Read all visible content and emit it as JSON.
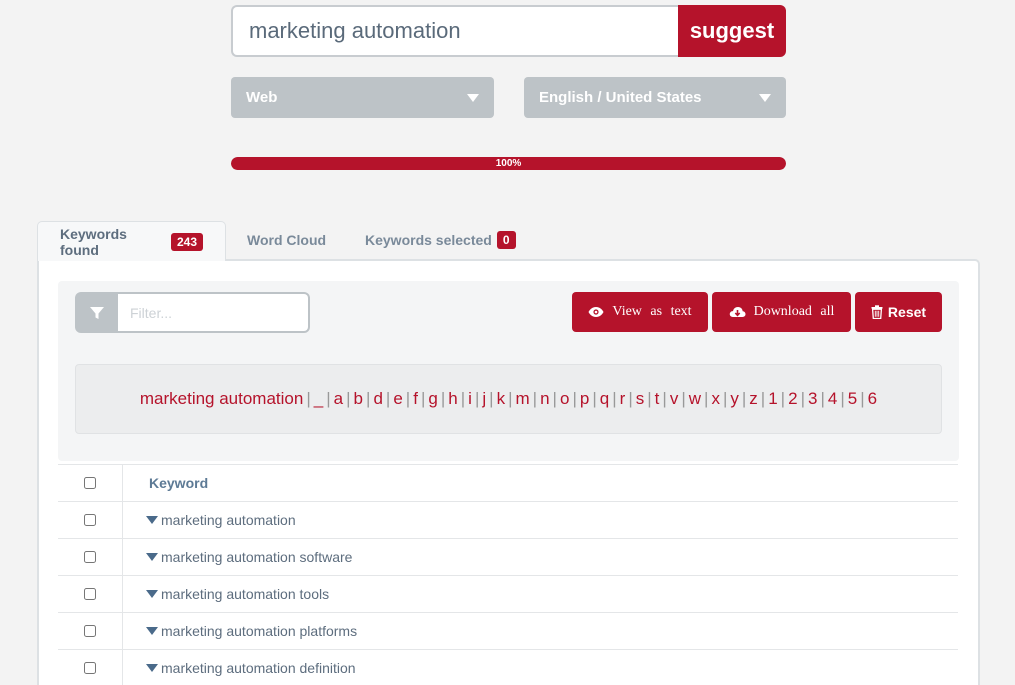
{
  "search": {
    "value": "marketing automation",
    "button_label": "suggest"
  },
  "filters": {
    "source": "Web",
    "language": "English / United States"
  },
  "progress": {
    "value": 100,
    "label": "100%"
  },
  "tabs": [
    {
      "label": "Keywords found",
      "badge": "243",
      "active": true
    },
    {
      "label": "Word Cloud",
      "badge": null,
      "active": false
    },
    {
      "label": "Keywords selected",
      "badge": "0",
      "active": false
    }
  ],
  "toolbar": {
    "filter_placeholder": "Filter...",
    "view_as_text_label": "View as text",
    "download_all_label": "Download all",
    "reset_label": "Reset"
  },
  "alphabet": {
    "base": "marketing automation",
    "letters": [
      "_",
      "a",
      "b",
      "d",
      "e",
      "f",
      "g",
      "h",
      "i",
      "j",
      "k",
      "m",
      "n",
      "o",
      "p",
      "q",
      "r",
      "s",
      "t",
      "v",
      "w",
      "x",
      "y",
      "z",
      "1",
      "2",
      "3",
      "4",
      "5",
      "6"
    ]
  },
  "table": {
    "header": "Keyword",
    "rows": [
      "marketing automation",
      "marketing automation software",
      "marketing automation tools",
      "marketing automation platforms",
      "marketing automation definition"
    ]
  },
  "colors": {
    "accent": "#b5132b",
    "select_bg": "#bdc3c7"
  }
}
